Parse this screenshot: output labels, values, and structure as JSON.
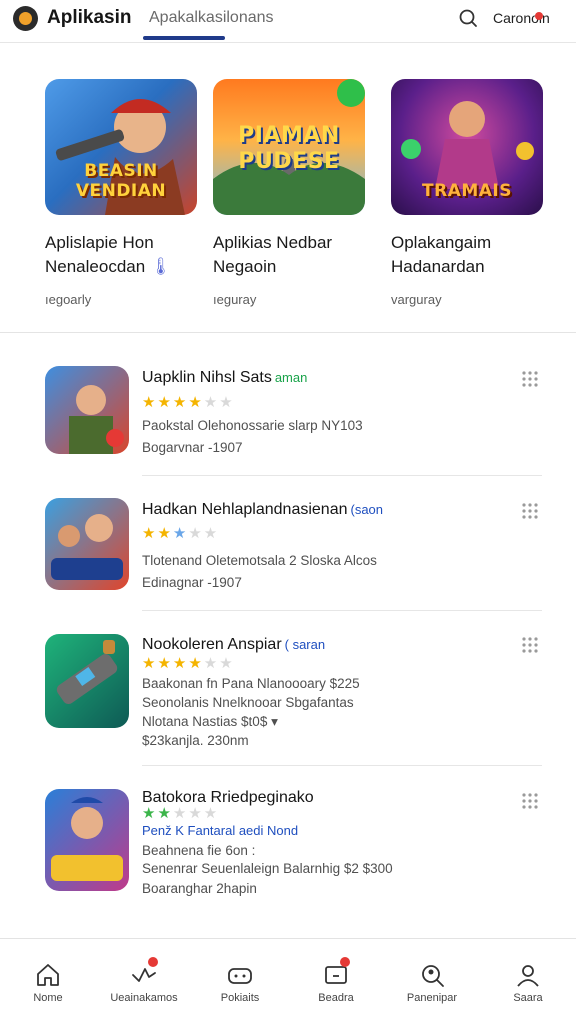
{
  "header": {
    "app_title": "Aplikasin",
    "tab_label": "Apakalkasilonans",
    "account_label": "Caronoin"
  },
  "featured": [
    {
      "thumb_text": "BEASIN VENDIAN",
      "name_line1": "Aplislapie Hon",
      "name_line2": "Nenaleocdan",
      "category": "ıegoarly",
      "colors": [
        "#3b7fd6",
        "#c9442a"
      ]
    },
    {
      "thumb_text": "PIAMAN PUDESE",
      "name_line1": "Aplikias Nedbar",
      "name_line2": "Negaoin",
      "category": "ıeguray",
      "colors": [
        "#ff9a2e",
        "#3a9bd8"
      ]
    },
    {
      "thumb_text": "TRAMAIS",
      "name_line1": "Oplakangaim",
      "name_line2": "Hadanardan",
      "category": "varguray",
      "colors": [
        "#5a1f8a",
        "#e0489a"
      ]
    }
  ],
  "apps": [
    {
      "title": "Uapklin Nihsl Sats",
      "tag": "aman",
      "tag_color": "green",
      "rating": 3,
      "line1": "Paokstal Olehonossarie slarp NY103",
      "line2": "Bogarvnar -1907",
      "line3": "",
      "line4": ""
    },
    {
      "title": "Hadkan Nehlaplandnasienan",
      "tag": "(saon",
      "tag_color": "blue",
      "rating": 3,
      "line1": "Tlotenand Oletemotsala 2 Sloska Alcos",
      "line2": "Edinagnar -1907",
      "line3": "",
      "line4": ""
    },
    {
      "title": "Nookoleren Anspiar",
      "tag": "( saran",
      "tag_color": "blue",
      "rating": 3,
      "line1": "Baakonan fn Pana Nlanoooary $225",
      "line2": "Seonolanis Nnelknooar Sbgafantas",
      "line3": "Nlotana Nastias $t0$ ▾",
      "line4": "$23kanjla.  230nm"
    },
    {
      "title": "Batokora Rriedpeginako",
      "tag": "Penž K  Fantaral aedi Nond",
      "tag_color": "blue",
      "rating": 2,
      "line1": "Beahnena  fie 6on       :",
      "line2": "Senenrar Seuenlaleign Balarnhig $2 $300",
      "line3": "Boaranghar  2hapin",
      "line4": ""
    }
  ],
  "nav": [
    {
      "label": "Nome"
    },
    {
      "label": "Ueainakamos"
    },
    {
      "label": "Pokiaits"
    },
    {
      "label": "Beadra"
    },
    {
      "label": "Panenipar"
    },
    {
      "label": "Saara"
    }
  ],
  "icons": [
    "search-icon",
    "more-dots-icon",
    "home-icon",
    "activity-icon",
    "gamepad-icon",
    "inbox-icon",
    "search-person-icon",
    "profile-icon"
  ]
}
